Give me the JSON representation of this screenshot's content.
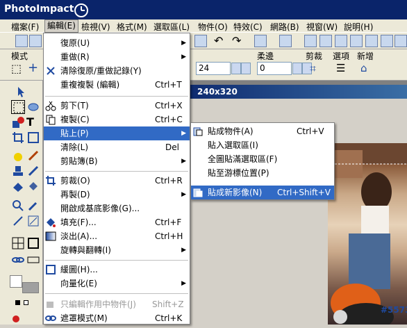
{
  "app": {
    "title": "PhotoImpact"
  },
  "menubar": {
    "items": [
      "檔案(F)",
      "編輯(E)",
      "檢視(V)",
      "格式(M)",
      "選取區(L)",
      "物件(O)",
      "特效(C)",
      "網路(B)",
      "視窗(W)",
      "說明(H)"
    ]
  },
  "toolbar2": {
    "mode_label": "模式",
    "soft_label": "柔邊",
    "crop_label": "剪裁",
    "options_label": "選項",
    "new_label": "新增",
    "size_value": "24",
    "soft_value": "0"
  },
  "image_window": {
    "title": "240x320"
  },
  "edit_menu": {
    "items": [
      {
        "label": "復原(U)",
        "shortcut": "",
        "arrow": true,
        "icon": ""
      },
      {
        "label": "重做(R)",
        "shortcut": "",
        "arrow": true,
        "icon": ""
      },
      {
        "label": "清除復原/重做記錄(Y)",
        "shortcut": "",
        "arrow": false,
        "icon": "clear-history-icon"
      },
      {
        "label": "重複複製 (編輯)",
        "shortcut": "Ctrl+T",
        "arrow": false,
        "icon": ""
      },
      {
        "label": "剪下(T)",
        "shortcut": "Ctrl+X",
        "arrow": false,
        "icon": "scissors-icon"
      },
      {
        "label": "複製(C)",
        "shortcut": "Ctrl+C",
        "arrow": false,
        "icon": "copy-icon"
      },
      {
        "label": "貼上(P)",
        "shortcut": "",
        "arrow": true,
        "icon": ""
      },
      {
        "label": "清除(L)",
        "shortcut": "Del",
        "arrow": false,
        "icon": ""
      },
      {
        "label": "剪貼簿(B)",
        "shortcut": "",
        "arrow": true,
        "icon": ""
      },
      {
        "label": "剪裁(O)",
        "shortcut": "Ctrl+R",
        "arrow": false,
        "icon": "crop-icon"
      },
      {
        "label": "再製(D)",
        "shortcut": "",
        "arrow": true,
        "icon": ""
      },
      {
        "label": "開啟成基底影像(G)...",
        "shortcut": "",
        "arrow": false,
        "icon": ""
      },
      {
        "label": "填充(F)...",
        "shortcut": "Ctrl+F",
        "arrow": false,
        "icon": "fill-icon"
      },
      {
        "label": "淡出(A)...",
        "shortcut": "Ctrl+H",
        "arrow": false,
        "icon": "fade-icon"
      },
      {
        "label": "旋轉與翻轉(I)",
        "shortcut": "",
        "arrow": true,
        "icon": ""
      },
      {
        "label": "緩圖(H)...",
        "shortcut": "",
        "arrow": false,
        "icon": "stroke-icon"
      },
      {
        "label": "向量化(E)",
        "shortcut": "",
        "arrow": true,
        "icon": ""
      },
      {
        "label": "只編輯作用中物件(J)",
        "shortcut": "Shift+Z",
        "arrow": false,
        "icon": "object-icon"
      },
      {
        "label": "遮罩模式(M)",
        "shortcut": "Ctrl+K",
        "arrow": false,
        "icon": "mask-icon"
      }
    ]
  },
  "paste_submenu": {
    "items": [
      {
        "label": "貼成物件(A)",
        "shortcut": "Ctrl+V",
        "icon": "paste-object-icon"
      },
      {
        "label": "貼入選取區(I)",
        "shortcut": "",
        "icon": ""
      },
      {
        "label": "全圖貼滿選取區(F)",
        "shortcut": "",
        "icon": ""
      },
      {
        "label": "貼至游標位置(P)",
        "shortcut": "",
        "icon": ""
      },
      {
        "label": "貼成新影像(N)",
        "shortcut": "Ctrl+Shift+V",
        "icon": "paste-new-image-icon"
      }
    ]
  },
  "watermark": "#5573"
}
